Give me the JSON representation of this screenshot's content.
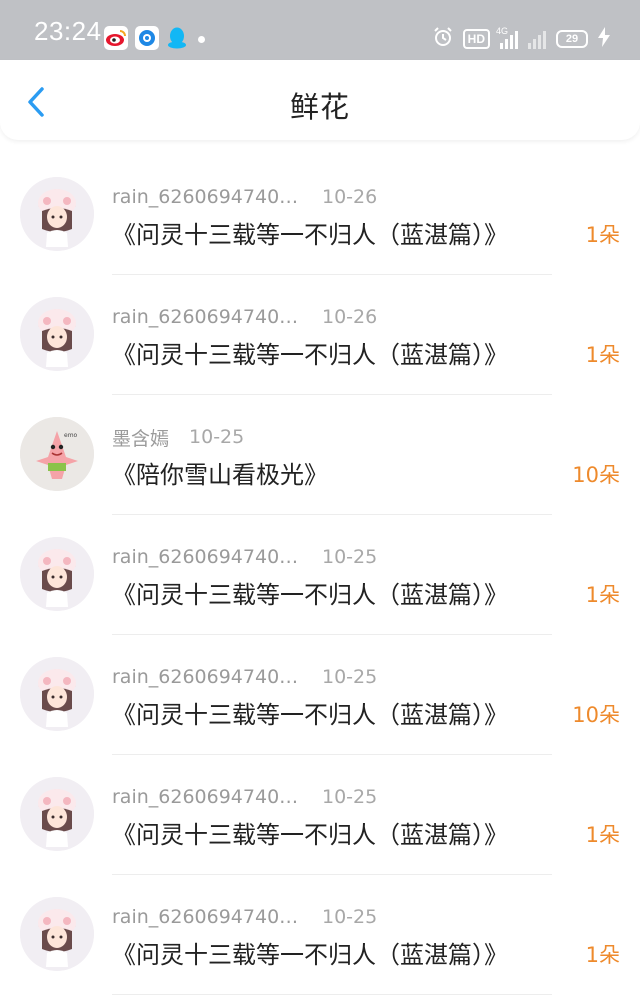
{
  "status_bar": {
    "time": "23:24",
    "apps": [
      "weibo-icon",
      "browser-icon",
      "qq-icon"
    ],
    "network": "4G",
    "hd": "HD",
    "battery": "29"
  },
  "nav": {
    "back_icon": "chevron-left-icon",
    "title": "鲜花"
  },
  "colors": {
    "status_bar_bg": "#bfc1c5",
    "accent_blue": "#2b9cf2",
    "count_orange": "#ee8a2c",
    "meta_gray": "#9a9a9a"
  },
  "records": [
    {
      "user": "rain_62606947403...",
      "date": "10-26",
      "title": "《问灵十三载等一不归人（蓝湛篇）》",
      "count": "1朵",
      "avatar": "girl-avatar"
    },
    {
      "user": "rain_62606947403...",
      "date": "10-26",
      "title": "《问灵十三载等一不归人（蓝湛篇）》",
      "count": "1朵",
      "avatar": "girl-avatar"
    },
    {
      "user": "墨含嫣",
      "date": "10-25",
      "title": "《陪你雪山看极光》",
      "count": "10朵",
      "avatar": "patrick-avatar"
    },
    {
      "user": "rain_62606947403...",
      "date": "10-25",
      "title": "《问灵十三载等一不归人（蓝湛篇）》",
      "count": "1朵",
      "avatar": "girl-avatar"
    },
    {
      "user": "rain_62606947403...",
      "date": "10-25",
      "title": "《问灵十三载等一不归人（蓝湛篇）》",
      "count": "10朵",
      "avatar": "girl-avatar"
    },
    {
      "user": "rain_62606947403...",
      "date": "10-25",
      "title": "《问灵十三载等一不归人（蓝湛篇）》",
      "count": "1朵",
      "avatar": "girl-avatar"
    },
    {
      "user": "rain_62606947403...",
      "date": "10-25",
      "title": "《问灵十三载等一不归人（蓝湛篇）》",
      "count": "1朵",
      "avatar": "girl-avatar"
    }
  ]
}
